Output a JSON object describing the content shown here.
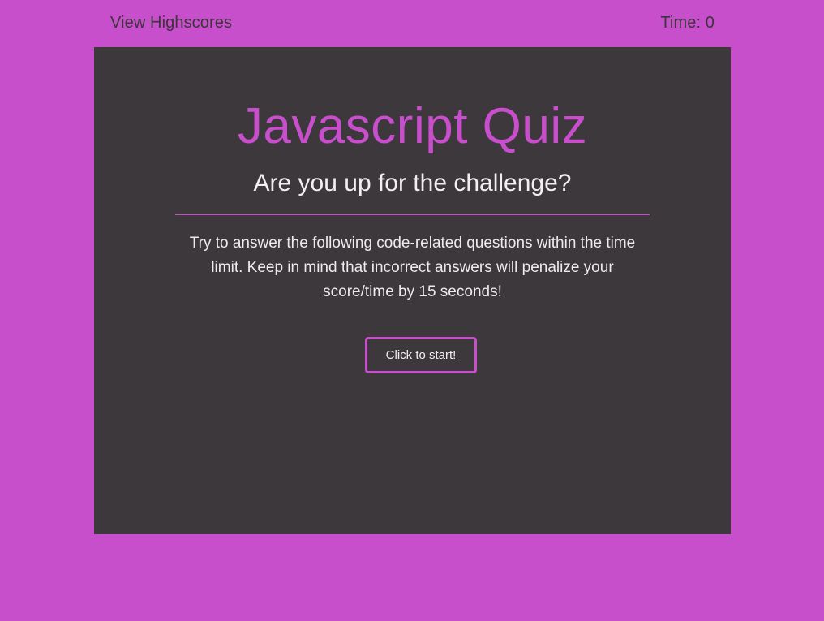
{
  "header": {
    "highscores_label": "View Highscores",
    "timer_text": "Time: 0"
  },
  "quiz": {
    "title": "Javascript Quiz",
    "subtitle": "Are you up for the challenge?",
    "instructions": "Try to answer the following code-related questions within the time limit. Keep in mind that incorrect answers will penalize your score/time by 15 seconds!",
    "start_label": "Click to start!"
  },
  "colors": {
    "background": "#c84fcb",
    "panel": "#3c383b",
    "accent": "#c84fcb",
    "text_light": "#f2eef2",
    "text_dark": "#3b363a"
  }
}
